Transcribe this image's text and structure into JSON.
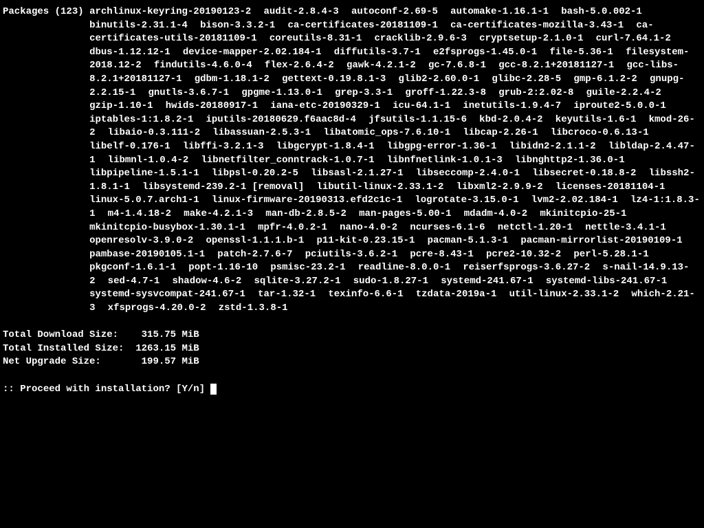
{
  "packages_header": {
    "label": "Packages",
    "count": 123
  },
  "packages": [
    "archlinux-keyring-20190123-2",
    "audit-2.8.4-3",
    "autoconf-2.69-5",
    "automake-1.16.1-1",
    "bash-5.0.002-1",
    "binutils-2.31.1-4",
    "bison-3.3.2-1",
    "ca-certificates-20181109-1",
    "ca-certificates-mozilla-3.43-1",
    "ca-certificates-utils-20181109-1",
    "coreutils-8.31-1",
    "cracklib-2.9.6-3",
    "cryptsetup-2.1.0-1",
    "curl-7.64.1-2",
    "dbus-1.12.12-1",
    "device-mapper-2.02.184-1",
    "diffutils-3.7-1",
    "e2fsprogs-1.45.0-1",
    "file-5.36-1",
    "filesystem-2018.12-2",
    "findutils-4.6.0-4",
    "flex-2.6.4-2",
    "gawk-4.2.1-2",
    "gc-7.6.8-1",
    "gcc-8.2.1+20181127-1",
    "gcc-libs-8.2.1+20181127-1",
    "gdbm-1.18.1-2",
    "gettext-0.19.8.1-3",
    "glib2-2.60.0-1",
    "glibc-2.28-5",
    "gmp-6.1.2-2",
    "gnupg-2.2.15-1",
    "gnutls-3.6.7-1",
    "gpgme-1.13.0-1",
    "grep-3.3-1",
    "groff-1.22.3-8",
    "grub-2:2.02-8",
    "guile-2.2.4-2",
    "gzip-1.10-1",
    "hwids-20180917-1",
    "iana-etc-20190329-1",
    "icu-64.1-1",
    "inetutils-1.9.4-7",
    "iproute2-5.0.0-1",
    "iptables-1:1.8.2-1",
    "iputils-20180629.f6aac8d-4",
    "jfsutils-1.1.15-6",
    "kbd-2.0.4-2",
    "keyutils-1.6-1",
    "kmod-26-2",
    "libaio-0.3.111-2",
    "libassuan-2.5.3-1",
    "libatomic_ops-7.6.10-1",
    "libcap-2.26-1",
    "libcroco-0.6.13-1",
    "libelf-0.176-1",
    "libffi-3.2.1-3",
    "libgcrypt-1.8.4-1",
    "libgpg-error-1.36-1",
    "libidn2-2.1.1-2",
    "libldap-2.4.47-1",
    "libmnl-1.0.4-2",
    "libnetfilter_conntrack-1.0.7-1",
    "libnfnetlink-1.0.1-3",
    "libnghttp2-1.36.0-1",
    "libpipeline-1.5.1-1",
    "libpsl-0.20.2-5",
    "libsasl-2.1.27-1",
    "libseccomp-2.4.0-1",
    "libsecret-0.18.8-2",
    "libssh2-1.8.1-1",
    "libsystemd-239.2-1 [removal]",
    "libutil-linux-2.33.1-2",
    "libxml2-2.9.9-2",
    "licenses-20181104-1",
    "linux-5.0.7.arch1-1",
    "linux-firmware-20190313.efd2c1c-1",
    "logrotate-3.15.0-1",
    "lvm2-2.02.184-1",
    "lz4-1:1.8.3-1",
    "m4-1.4.18-2",
    "make-4.2.1-3",
    "man-db-2.8.5-2",
    "man-pages-5.00-1",
    "mdadm-4.0-2",
    "mkinitcpio-25-1",
    "mkinitcpio-busybox-1.30.1-1",
    "mpfr-4.0.2-1",
    "nano-4.0-2",
    "ncurses-6.1-6",
    "netctl-1.20-1",
    "nettle-3.4.1-1",
    "openresolv-3.9.0-2",
    "openssl-1.1.1.b-1",
    "p11-kit-0.23.15-1",
    "pacman-5.1.3-1",
    "pacman-mirrorlist-20190109-1",
    "pambase-20190105.1-1",
    "patch-2.7.6-7",
    "pciutils-3.6.2-1",
    "pcre-8.43-1",
    "pcre2-10.32-2",
    "perl-5.28.1-1",
    "pkgconf-1.6.1-1",
    "popt-1.16-10",
    "psmisc-23.2-1",
    "readline-8.0.0-1",
    "reiserfsprogs-3.6.27-2",
    "s-nail-14.9.13-2",
    "sed-4.7-1",
    "shadow-4.6-2",
    "sqlite-3.27.2-1",
    "sudo-1.8.27-1",
    "systemd-241.67-1",
    "systemd-libs-241.67-1",
    "systemd-sysvcompat-241.67-1",
    "tar-1.32-1",
    "texinfo-6.6-1",
    "tzdata-2019a-1",
    "util-linux-2.33.1-2",
    "which-2.21-3",
    "xfsprogs-4.20.0-2",
    "zstd-1.3.8-1"
  ],
  "sizes": {
    "download": {
      "label": "Total Download Size:",
      "value": "315.75",
      "unit": "MiB"
    },
    "installed": {
      "label": "Total Installed Size:",
      "value": "1263.15",
      "unit": "MiB"
    },
    "upgrade": {
      "label": "Net Upgrade Size:",
      "value": "199.57",
      "unit": "MiB"
    }
  },
  "prompt": {
    "prefix": ":: ",
    "question": "Proceed with installation?",
    "options": "[Y/n]"
  }
}
